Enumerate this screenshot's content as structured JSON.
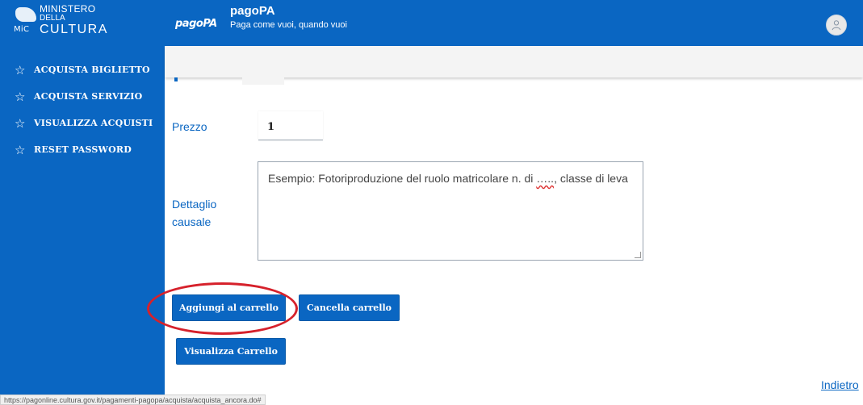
{
  "sidebar": {
    "logo": {
      "line1": "MINISTERO",
      "line2": "DELLA",
      "line3": "CULTURA",
      "mic": "MiC"
    },
    "items": [
      {
        "label": "ACQUISTA BIGLIETTO",
        "icon": "star-outline-icon"
      },
      {
        "label": "ACQUISTA SERVIZIO",
        "icon": "star-outline-icon"
      },
      {
        "label": "VISUALIZZA ACQUISTI",
        "icon": "star-outline-icon"
      },
      {
        "label": "RESET PASSWORD",
        "icon": "star-outline-icon"
      }
    ]
  },
  "header": {
    "logo_text": "pagoPA",
    "title": "pagoPA",
    "subtitle": "Paga come vuoi, quando vuoi",
    "avatar_icon": "user-icon"
  },
  "form": {
    "price_label": "Prezzo",
    "price_value": "1",
    "causale_label_line1": "Dettaglio",
    "causale_label_line2": "causale",
    "causale_text_before": "Esempio: Fotoriproduzione del ruolo matricolare n. di ",
    "causale_text_dots": "…..",
    "causale_text_after": ", classe di leva"
  },
  "buttons": {
    "add_to_cart": "Aggiungi al carrello",
    "clear_cart": "Cancella carrello",
    "view_cart": "Visualizza Carrello"
  },
  "back_link": "Indietro",
  "status_url": "https://pagonline.cultura.gov.it/pagamenti-pagopa/acquista/acquista_ancora.do#",
  "colors": {
    "primary": "#0a66c2",
    "highlight": "#d6212b"
  }
}
